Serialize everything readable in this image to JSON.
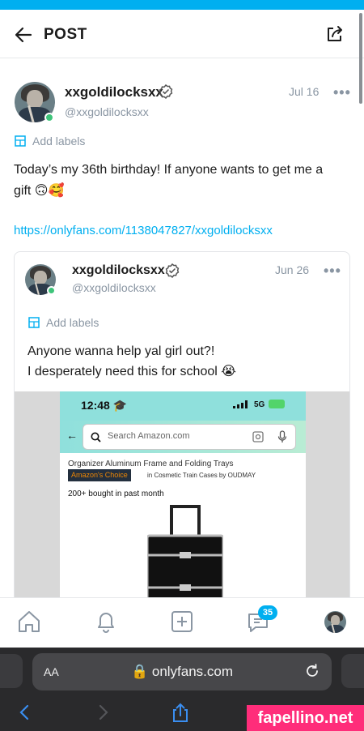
{
  "header": {
    "title": "POST"
  },
  "post": {
    "name": "xxgoldilocksxx",
    "handle": "@xxgoldilocksxx",
    "date": "Jul 16",
    "more": "•••",
    "labels_text": "Add labels",
    "text_line1": "Today’s my 36th birthday! If anyone wants to get me a",
    "text_line2": "gift 🙃🥰",
    "link": "https://onlyfans.com/1138047827/xxgoldilocksxx"
  },
  "quoted": {
    "name": "xxgoldilocksxx",
    "handle": "@xxgoldilocksxx",
    "date": "Jun 26",
    "more": "•••",
    "labels_text": "Add labels",
    "text_line1": "Anyone wanna help yal girl out?!",
    "text_line2": "I desperately need this for school 😭",
    "media": {
      "time": "12:48 🎓",
      "network": "5G",
      "search_placeholder": "Search Amazon.com",
      "product_title": "Organizer Aluminum Frame and Folding Trays",
      "choice_badge_prefix": "Amazon's",
      "choice_badge_suffix": "Choice",
      "choice_category": "in Cosmetic Train Cases by OUDMAY",
      "bought": "200+ bought in past month"
    }
  },
  "nav": {
    "messages_badge": "35"
  },
  "browser": {
    "aa": "AA",
    "url": "🔒 onlyfans.com"
  },
  "watermark": "fapellino.net",
  "colors": {
    "accent": "#00aff0",
    "online": "#3ec47a",
    "muted": "#8a96a3"
  }
}
